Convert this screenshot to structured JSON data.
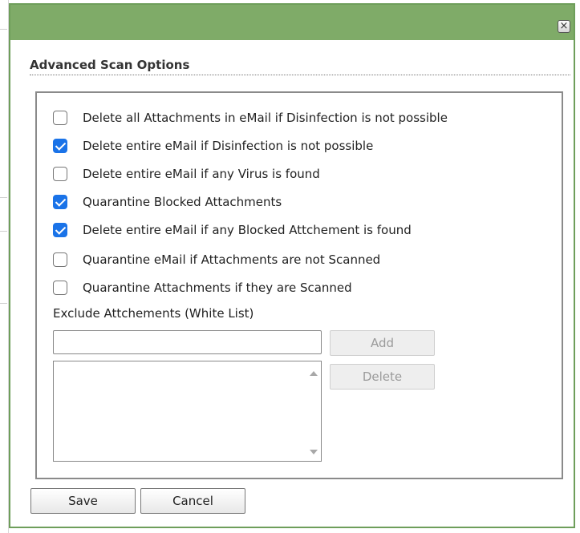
{
  "dialog": {
    "close_glyph": "×",
    "section_title": "Advanced Scan Options"
  },
  "options": [
    {
      "label": "Delete all Attachments in eMail if Disinfection is not possible",
      "checked": false
    },
    {
      "label": "Delete entire eMail if Disinfection is not possible",
      "checked": true
    },
    {
      "label": "Delete entire eMail if any Virus is found",
      "checked": false
    },
    {
      "label": "Quarantine Blocked Attachments",
      "checked": true
    },
    {
      "label": "Delete entire eMail if any Blocked Attchement is found",
      "checked": true
    },
    {
      "label": "Quarantine eMail if Attachments are not Scanned",
      "checked": false
    },
    {
      "label": "Quarantine Attachments if they are Scanned",
      "checked": false
    }
  ],
  "exclude": {
    "label": "Exclude Attchements (White List)",
    "input_value": "",
    "add_label": "Add",
    "delete_label": "Delete",
    "list_items": []
  },
  "footer": {
    "save_label": "Save",
    "cancel_label": "Cancel"
  },
  "colors": {
    "titlebar": "#7fab68",
    "checkbox_checked": "#1a73e8"
  }
}
